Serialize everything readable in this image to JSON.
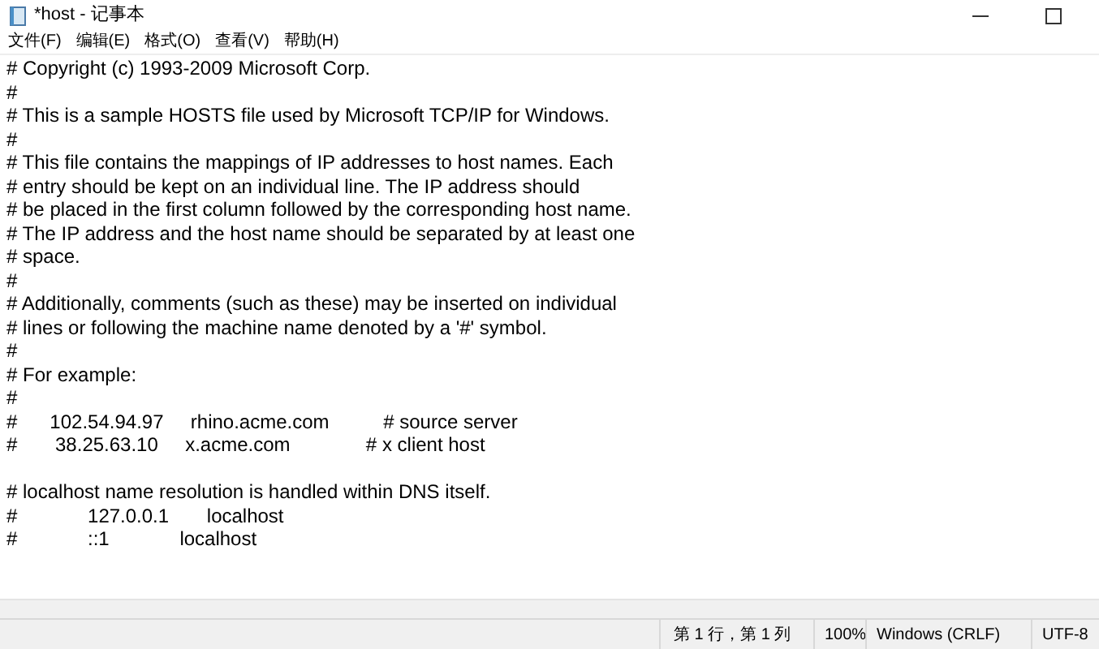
{
  "window": {
    "title": "*host - 记事本"
  },
  "menu": [
    "文件(F)",
    "编辑(E)",
    "格式(O)",
    "查看(V)",
    "帮助(H)"
  ],
  "lines": [
    {
      "kind": "text",
      "text": "# Copyright (c) 1993-2009 Microsoft Corp."
    },
    {
      "kind": "text",
      "text": "#"
    },
    {
      "kind": "text",
      "text": "# This is a sample HOSTS file used by Microsoft TCP/IP for Windows."
    },
    {
      "kind": "text",
      "text": "#"
    },
    {
      "kind": "text",
      "text": "# This file contains the mappings of IP addresses to host names. Each"
    },
    {
      "kind": "text",
      "text": "# entry should be kept on an individual line. The IP address should"
    },
    {
      "kind": "text",
      "text": "# be placed in the first column followed by the corresponding host name."
    },
    {
      "kind": "text",
      "text": "# The IP address and the host name should be separated by at least one"
    },
    {
      "kind": "text",
      "text": "# space."
    },
    {
      "kind": "text",
      "text": "#"
    },
    {
      "kind": "text",
      "text": "# Additionally, comments (such as these) may be inserted on individual"
    },
    {
      "kind": "text",
      "text": "# lines or following the machine name denoted by a '#' symbol."
    },
    {
      "kind": "text",
      "text": "#"
    },
    {
      "kind": "text",
      "text": "# For example:"
    },
    {
      "kind": "text",
      "text": "#"
    },
    {
      "kind": "text",
      "text": "#      102.54.94.97     rhino.acme.com          # source server"
    },
    {
      "kind": "text",
      "text": "#       38.25.63.10     x.acme.com              # x client host"
    },
    {
      "kind": "blank"
    },
    {
      "kind": "text",
      "text": "# localhost name resolution is handled within DNS itself."
    },
    {
      "kind": "text",
      "text": "#             127.0.0.1       localhost"
    },
    {
      "kind": "text",
      "text": "#             ::1             localhost"
    }
  ],
  "status_bar": {
    "position": "第 1 行，第 1 列",
    "zoom": "100%",
    "line_ending": "Windows (CRLF)",
    "encoding": "UTF-8"
  }
}
